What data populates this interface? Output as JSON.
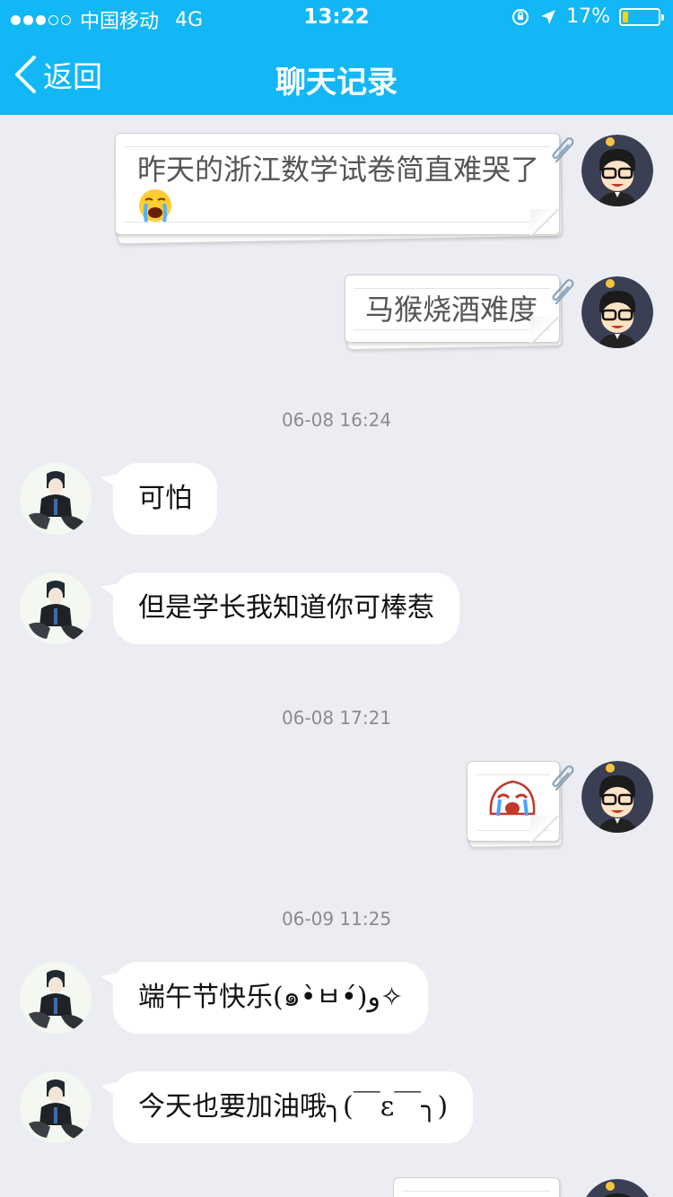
{
  "status_bar": {
    "carrier": "中国移动",
    "network": "4G",
    "time": "13:22",
    "battery": "17%",
    "battery_level": 0.17
  },
  "nav": {
    "back_label": "返回",
    "title": "聊天记录"
  },
  "messages": [
    {
      "from": "self",
      "type": "text",
      "text": "昨天的浙江数学试卷简直难哭了",
      "emoji": "crying-face"
    },
    {
      "from": "self",
      "type": "text",
      "text": "马猴烧酒难度"
    },
    {
      "type": "timestamp",
      "text": "06-08 16:24"
    },
    {
      "from": "other",
      "type": "text",
      "text": "可怕"
    },
    {
      "from": "other",
      "type": "text",
      "text": "但是学长我知道你可棒惹"
    },
    {
      "type": "timestamp",
      "text": "06-08 17:21"
    },
    {
      "from": "self",
      "type": "sticker",
      "sticker": "crying-cartoon-sticker"
    },
    {
      "type": "timestamp",
      "text": "06-09 11:25"
    },
    {
      "from": "other",
      "type": "text",
      "text": "端午节快乐(๑•̀ㅂ•́)و✧"
    },
    {
      "from": "other",
      "type": "text",
      "text": "今天也要加油哦╮(￣ε￣╮)"
    }
  ],
  "colors": {
    "header_bg": "#12b7f5",
    "chat_bg": "#ebedf2",
    "bubble_other": "#ffffff",
    "timestamp": "#8c8c8c"
  }
}
